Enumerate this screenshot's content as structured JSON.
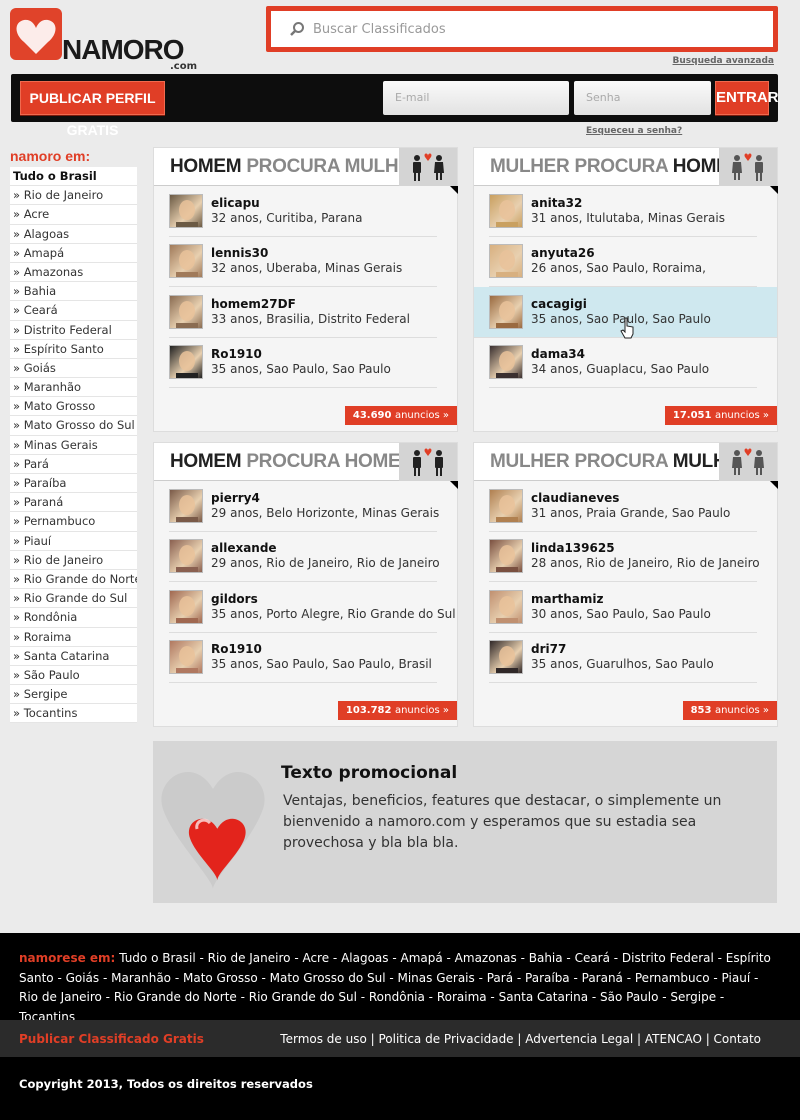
{
  "header": {
    "logo_text": "NAMORO",
    "logo_suffix": ".com",
    "search_placeholder": "Buscar Classificados",
    "advanced_search": "Busqueda avanzada"
  },
  "topbar": {
    "publish_button": "PUBLICAR PERFIL GRATIS",
    "email_placeholder": "E-mail",
    "password_placeholder": "Senha",
    "login_button": "ENTRAR",
    "forgot_link": "Esqueceu a senha?"
  },
  "sidebar": {
    "title": "namoro em:",
    "items": [
      "Tudo o Brasil",
      "» Rio de Janeiro",
      "» Acre",
      "» Alagoas",
      "» Amapá",
      "» Amazonas",
      "» Bahia",
      "» Ceará",
      "» Distrito Federal",
      "» Espírito Santo",
      "» Goiás",
      "» Maranhão",
      "» Mato Grosso",
      "» Mato Grosso do Sul",
      "» Minas Gerais",
      "» Pará",
      "» Paraíba",
      "» Paraná",
      "» Pernambuco",
      "» Piauí",
      "» Rio de Janeiro",
      "» Rio Grande do Norte",
      "» Rio Grande do Sul",
      "» Rondônia",
      "» Roraima",
      "» Santa Catarina",
      "» São Paulo",
      "» Sergipe",
      "» Tocantins"
    ]
  },
  "panels": [
    {
      "title_a": "HOMEM",
      "title_b": "PROCURA",
      "title_c": "MULHER",
      "icon": "man-heart-woman-icon",
      "count": "43.690",
      "count_label": "anuncios »",
      "users": [
        {
          "name": "elicapu",
          "info": "32 anos, Curitiba, Parana"
        },
        {
          "name": "lennis30",
          "info": "32 anos, Uberaba, Minas Gerais"
        },
        {
          "name": "homem27DF",
          "info": "33 anos, Brasilia, Distrito Federal"
        },
        {
          "name": "Ro1910",
          "info": "35 anos, Sao Paulo, Sao Paulo"
        }
      ]
    },
    {
      "title_a": "MULHER",
      "title_b": "PROCURA",
      "title_c": "HOMEM",
      "icon": "woman-heart-man-icon",
      "count": "17.051",
      "count_label": "anuncios »",
      "users": [
        {
          "name": "anita32",
          "info": "31 anos, Itulutaba, Minas Gerais"
        },
        {
          "name": "anyuta26",
          "info": "26 anos, Sao Paulo, Roraima,"
        },
        {
          "name": "cacagigi",
          "info": "35 anos, Sao Paulo, Sao Paulo"
        },
        {
          "name": "dama34",
          "info": "34 anos, Guaplacu, Sao Paulo"
        }
      ]
    },
    {
      "title_a": "HOMEM",
      "title_b": "PROCURA",
      "title_c": "HOMEM",
      "icon": "man-heart-man-icon",
      "count": "103.782",
      "count_label": "anuncios »",
      "users": [
        {
          "name": "pierry4",
          "info": "29 anos, Belo Horizonte, Minas Gerais"
        },
        {
          "name": "allexande",
          "info": "29 anos, Rio de Janeiro, Rio de Janeiro"
        },
        {
          "name": "gildors",
          "info": "35 anos, Porto Alegre, Rio Grande do Sul"
        },
        {
          "name": "Ro1910",
          "info": "35 anos, Sao Paulo, Sao Paulo, Brasil"
        }
      ]
    },
    {
      "title_a": "MULHER",
      "title_b": "PROCURA",
      "title_c": "MULHER",
      "icon": "woman-heart-woman-icon",
      "count": "853",
      "count_label": "anuncios »",
      "users": [
        {
          "name": "claudianeves",
          "info": "31 anos, Praia Grande, Sao Paulo"
        },
        {
          "name": "linda139625",
          "info": "28 anos, Rio de Janeiro, Rio de Janeiro"
        },
        {
          "name": "marthamiz",
          "info": "30 anos, Sao Paulo, Sao Paulo"
        },
        {
          "name": "dri77",
          "info": "35 anos, Guarulhos, Sao Paulo"
        }
      ]
    }
  ],
  "promo": {
    "title": "Texto promocional",
    "text": "Ventajas, beneficios, features que destacar, o simplemente un bienvenido a namoro.com y esperamos que su estadia sea provechosa y bla bla bla."
  },
  "footer": {
    "label": "namorese em:",
    "states": "Tudo o Brasil - Rio de Janeiro - Acre - Alagoas - Amapá - Amazonas - Bahia - Ceará - Distrito Federal - Espírito Santo - Goiás - Maranhão - Mato Grosso - Mato Grosso do Sul - Minas Gerais - Pará - Paraíba - Paraná - Pernambuco - Piauí - Rio de Janeiro - Rio Grande do Norte - Rio Grande do Sul - Rondônia - Roraima - Santa Catarina - São Paulo - Sergipe - Tocantins",
    "publish_link": "Publicar Classificado Gratis",
    "legal_links": "Termos de uso | Politica de Privacidade | Advertencia Legal | ATENCAO | Contato",
    "copyright": "Copyright 2013, Todos os direitos reservados"
  },
  "colors": {
    "accent": "#e03e26",
    "dark": "#0d0d0d",
    "highlight": "#cfe8ef"
  }
}
